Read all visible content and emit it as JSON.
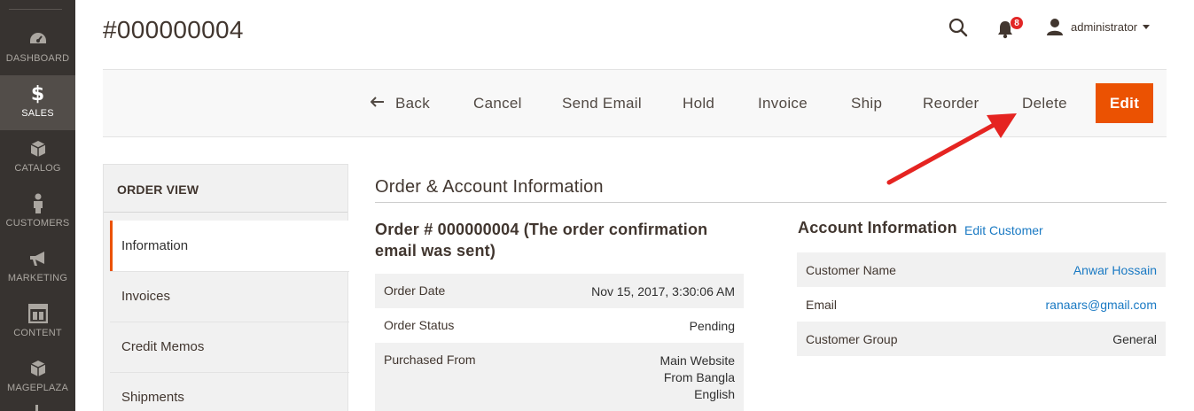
{
  "nav": {
    "items": [
      {
        "label": "DASHBOARD",
        "icon": "dashboard-icon"
      },
      {
        "label": "SALES",
        "icon": "dollar-icon",
        "active": true
      },
      {
        "label": "CATALOG",
        "icon": "cube-icon"
      },
      {
        "label": "CUSTOMERS",
        "icon": "person-icon"
      },
      {
        "label": "MARKETING",
        "icon": "megaphone-icon"
      },
      {
        "label": "CONTENT",
        "icon": "layout-icon"
      },
      {
        "label": "MAGEPLAZA",
        "icon": "cube-icon"
      }
    ]
  },
  "header": {
    "title": "#000000004",
    "notifications_count": "8",
    "username": "administrator"
  },
  "toolbar": {
    "back_label": "Back",
    "cancel_label": "Cancel",
    "send_email_label": "Send Email",
    "hold_label": "Hold",
    "invoice_label": "Invoice",
    "ship_label": "Ship",
    "reorder_label": "Reorder",
    "delete_label": "Delete",
    "edit_label": "Edit"
  },
  "sidebar": {
    "heading": "ORDER VIEW",
    "items": [
      {
        "label": "Information",
        "active": true
      },
      {
        "label": "Invoices"
      },
      {
        "label": "Credit Memos"
      },
      {
        "label": "Shipments"
      }
    ]
  },
  "main": {
    "section_title": "Order & Account Information",
    "order_title": "Order # 000000004 (The order confirmation email was sent)",
    "order_rows": [
      {
        "label": "Order Date",
        "value": "Nov 15, 2017, 3:30:06 AM"
      },
      {
        "label": "Order Status",
        "value": "Pending"
      },
      {
        "label": "Purchased From",
        "value_lines": [
          "Main Website",
          "From Bangla",
          "English"
        ]
      }
    ],
    "account_title": "Account Information",
    "account_edit_label": "Edit Customer",
    "account_rows": [
      {
        "label": "Customer Name",
        "value": "Anwar Hossain"
      },
      {
        "label": "Email",
        "value": "ranaars@gmail.com"
      },
      {
        "label": "Customer Group",
        "value": "General"
      }
    ]
  },
  "colors": {
    "accent": "#eb5202",
    "link": "#1979c3",
    "nav_bg": "#373330",
    "annotation_arrow": "#e52421"
  }
}
